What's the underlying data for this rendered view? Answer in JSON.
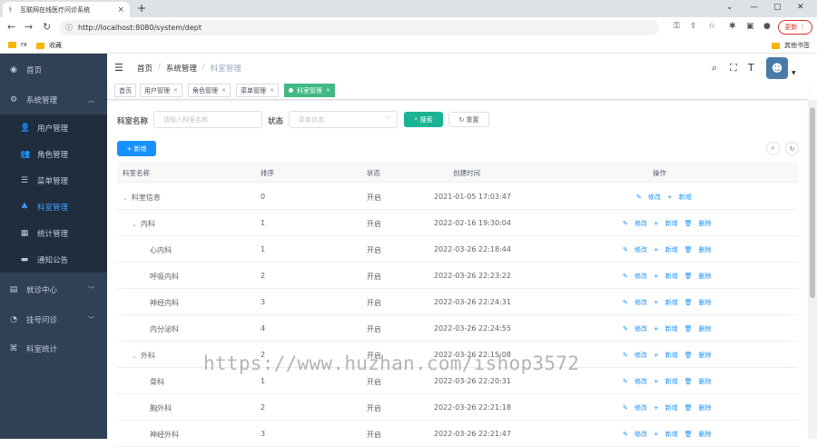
{
  "browser": {
    "tab_title": "互联网在线医疗问诊系统",
    "url": "http://localhost:8080/system/dept",
    "update_label": "更新",
    "bookmarks": [
      "rx",
      "收藏"
    ],
    "other_bookmarks": "其他书签"
  },
  "sidebar": {
    "items": [
      {
        "label": "首页",
        "icon": "dashboard-icon"
      },
      {
        "label": "系统管理",
        "icon": "gear-icon",
        "expanded": true
      },
      {
        "label": "用户管理",
        "icon": "user-icon"
      },
      {
        "label": "角色管理",
        "icon": "users-icon"
      },
      {
        "label": "菜单管理",
        "icon": "tree-icon"
      },
      {
        "label": "科室管理",
        "icon": "org-icon",
        "active": true
      },
      {
        "label": "统计管理",
        "icon": "chart-icon"
      },
      {
        "label": "通知公告",
        "icon": "message-icon"
      },
      {
        "label": "就诊中心",
        "icon": "clinic-icon"
      },
      {
        "label": "挂号问诊",
        "icon": "register-icon"
      },
      {
        "label": "科室统计",
        "icon": "stats-icon"
      }
    ]
  },
  "navbar": {
    "breadcrumb": [
      "首页",
      "系统管理",
      "科室管理"
    ]
  },
  "tags": [
    {
      "label": "首页"
    },
    {
      "label": "用户管理"
    },
    {
      "label": "角色管理"
    },
    {
      "label": "菜单管理"
    },
    {
      "label": "科室管理",
      "active": true
    }
  ],
  "search": {
    "dept_label": "科室名称",
    "dept_placeholder": "请输入科室名称",
    "status_label": "状态",
    "status_placeholder": "菜单状态",
    "search_btn": "搜索",
    "reset_btn": "重置",
    "add_btn": "新增"
  },
  "table": {
    "headers": [
      "科室名称",
      "排序",
      "状态",
      "创建时间",
      "操作"
    ],
    "ops": {
      "edit": "修改",
      "add": "新增",
      "delete": "删除"
    },
    "rows": [
      {
        "name": "科室信息",
        "order": "0",
        "status": "开启",
        "time": "2021-01-05 17:03:47"
      },
      {
        "name": "内科",
        "order": "1",
        "status": "开启",
        "time": "2022-02-16 19:30:04"
      },
      {
        "name": "心内科",
        "order": "1",
        "status": "开启",
        "time": "2022-03-26 22:18:44"
      },
      {
        "name": "呼吸内科",
        "order": "2",
        "status": "开启",
        "time": "2022-03-26 22:23:22"
      },
      {
        "name": "神经内科",
        "order": "3",
        "status": "开启",
        "time": "2022-03-26 22:24:31"
      },
      {
        "name": "内分泌科",
        "order": "4",
        "status": "开启",
        "time": "2022-03-26 22:24:55"
      },
      {
        "name": "外科",
        "order": "2",
        "status": "开启",
        "time": "2022-03-26 22:15:08"
      },
      {
        "name": "骨科",
        "order": "1",
        "status": "开启",
        "time": "2022-03-26 22:20:31"
      },
      {
        "name": "胸外科",
        "order": "2",
        "status": "开启",
        "time": "2022-03-26 22:21:18"
      },
      {
        "name": "神经外科",
        "order": "3",
        "status": "开启",
        "time": "2022-03-26 22:21:47"
      }
    ]
  },
  "watermark": "https://www.huzhan.com/ishop3572"
}
